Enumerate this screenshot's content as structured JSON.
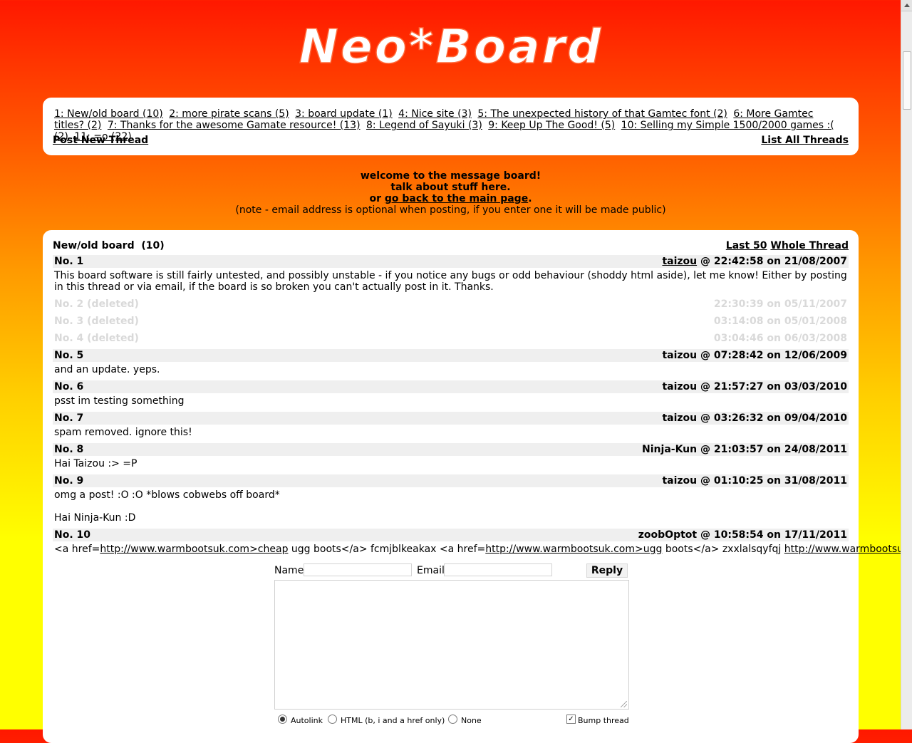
{
  "logo": {
    "text": "Neo*Board",
    "color": "#ffffff"
  },
  "nav": {
    "threads": [
      "1: New/old board (10)",
      "2: more pirate scans (5)",
      "3: board update (1)",
      "4: Nice site (3)",
      "5: The unexpected history of that Gamtec font (2)",
      "6: More Gamtec titles? (2)",
      "7: Thanks for the awesome Gamate resource! (13)",
      "8: Legend of Sayuki (3)",
      "9: Keep Up The Good! (5)",
      "10: Selling my Simple 1500/2000 games :( (2)",
      "11: =o (22)"
    ],
    "post_new_thread": "Post New Thread",
    "list_all_threads": "List All Threads"
  },
  "welcome": {
    "line1": "welcome to the message board!",
    "line2": "talk about stuff here.",
    "line3_prefix": "or",
    "line3_link": "go back to the main page",
    "line3_suffix": ".",
    "note": "(note - email address is optional when posting, if you enter one it will be made public)"
  },
  "thread": {
    "title": "New/old board",
    "count": "(10)",
    "last50": "Last 50",
    "whole_thread": "Whole Thread",
    "posts": [
      {
        "num": "No. 1",
        "author": "taizou",
        "time": "@ 22:42:58 on 21/08/2007",
        "body": "This board software is still fairly untested, and possibly unstable - if you notice any bugs or odd behaviour (shoddy html aside), let me know! Either by posting in this thread or via email, if the board is so broken you can't actually post in it. Thanks."
      },
      {
        "num": "No. 2 (deleted)",
        "time": "22:30:39 on 05/11/2007"
      },
      {
        "num": "No. 3 (deleted)",
        "time": "03:14:08 on 05/01/2008"
      },
      {
        "num": "No. 4 (deleted)",
        "time": "03:04:46 on 06/03/2008"
      },
      {
        "num": "No. 5",
        "author": "taizou",
        "time": "@ 07:28:42 on 12/06/2009",
        "body": "and an update. yeps."
      },
      {
        "num": "No. 6",
        "author": "taizou",
        "time": "@ 21:57:27 on 03/03/2010",
        "body": "psst im testing something"
      },
      {
        "num": "No. 7",
        "author": "taizou",
        "time": "@ 03:26:32 on 09/04/2010",
        "body": "spam removed. ignore this!"
      },
      {
        "num": "No. 8",
        "author": "Ninja-Kun",
        "time": "@ 21:03:57 on 24/08/2011",
        "body": "Hai Taizou :> =P"
      },
      {
        "num": "No. 9",
        "author": "taizou",
        "time": "@ 01:10:25 on 31/08/2011",
        "body": "omg a post! :O :O *blows cobwebs off board*",
        "body2": "Hai Ninja-Kun :D"
      },
      {
        "num": "No. 10",
        "author": "zoobOptot",
        "time": "@ 10:58:54 on 17/11/2011",
        "body_parts": [
          "<a href=",
          "http://www.warmbootsuk.com>cheap",
          " ugg boots</a> fcmjblkeakax <a href=",
          "http://www.warmbootsuk.com>ugg",
          " boots</a> zxxlalsqyfqj ",
          "http://www.warmbootsuk.com"
        ]
      }
    ]
  },
  "form": {
    "name_label": "Name",
    "email_label": "Email",
    "reply_label": "Reply",
    "name_value": "",
    "email_value": "",
    "message_value": "",
    "options": {
      "autolink": "Autolink",
      "html": "HTML (b, i and a href only)",
      "none": "None",
      "bump": "Bump thread"
    },
    "bump_mark": "✓"
  }
}
